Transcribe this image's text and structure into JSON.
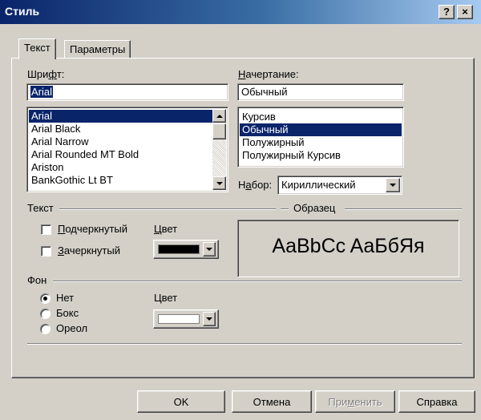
{
  "window": {
    "title": "Стиль",
    "help_button": "?",
    "close_button": "×"
  },
  "tabs": [
    {
      "label": "Текст",
      "active": true
    },
    {
      "label": "Параметры",
      "active": false
    }
  ],
  "font": {
    "label_before": "Шри",
    "label_underlined": "ф",
    "label_after": "т:",
    "value": "Arial",
    "list": [
      "Arial",
      "Arial Black",
      "Arial Narrow",
      "Arial Rounded MT Bold",
      "Ariston",
      "BankGothic Lt BT"
    ],
    "selected_index": 0
  },
  "style": {
    "label_underlined": "Н",
    "label_after": "ачертание:",
    "value": "Обычный",
    "list": [
      "Курсив",
      "Обычный",
      "Полужирный",
      "Полужирный Курсив"
    ],
    "selected_index": 1
  },
  "charset": {
    "label_before": "Н",
    "label_underlined": "а",
    "label_after": "бор:",
    "value": "Кириллический"
  },
  "text_group": {
    "title": "Текст",
    "underline_underlined": "П",
    "underline_after": "одчеркнутый",
    "underline_checked": false,
    "strike_underlined": "З",
    "strike_after": "ачеркнутый",
    "strike_checked": false,
    "color_label_underlined": "Ц",
    "color_label_after": "вет",
    "color_value": "#000000"
  },
  "sample_group": {
    "title": "Образец",
    "sample_text": "AaBbCc AaБбЯя"
  },
  "background_group": {
    "title": "Фон",
    "options": [
      "Нет",
      "Бокс",
      "Ореол"
    ],
    "selected_index": 0,
    "color_label": "Цвет",
    "color_value": "#ffffff"
  },
  "buttons": {
    "ok": "OK",
    "cancel": "Отмена",
    "apply_before": "При",
    "apply_underlined": "м",
    "apply_after": "енить",
    "apply_enabled": false,
    "help": "Справка"
  }
}
